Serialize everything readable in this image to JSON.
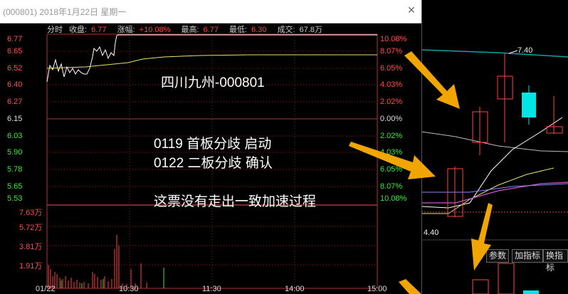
{
  "window": {
    "title": "(000801) 2018年1月22日 星期一",
    "close_icon": "×"
  },
  "info": {
    "mode": "分时",
    "close_label": "收盘:",
    "close_value": "6.77",
    "change_label": "涨幅:",
    "change_value": "+10.08%",
    "high_label": "最高:",
    "high_value": "6.77",
    "low_label": "最低:",
    "low_value": "6.30",
    "volume_label": "成交:",
    "volume_value": "67.8万"
  },
  "price_axis": [
    "6.77",
    "6.65",
    "6.52",
    "6.40",
    "6.27",
    "6.15",
    "6.03",
    "5.90",
    "5.78",
    "5.65",
    "5.53"
  ],
  "pct_axis": [
    "10.08%",
    "8.07%",
    "6.05%",
    "4.03%",
    "2.02%",
    "0.00%",
    "2.02%",
    "4.03%",
    "6.05%",
    "8.07%",
    "10.08%"
  ],
  "volume_axis": [
    "7.63万",
    "5.72万",
    "3.81万",
    "1.91万"
  ],
  "time_axis": [
    "01/22",
    "10:30",
    "11:30",
    "14:00",
    "15:00"
  ],
  "annotations": {
    "stock": "四川九州-000801",
    "line1": "0119 首板分歧 启动",
    "line2": "0122 二板分歧 确认",
    "line3": "这票没有走出一致加速过程"
  },
  "kline": {
    "high_label": "7.40",
    "low_label": "4.40"
  },
  "buttons": {
    "params": "参数",
    "add_indicator": "加指标",
    "switch_indicator": "换指标"
  },
  "colors": {
    "up": "#ff4444",
    "down": "#00e5e5",
    "arrow": "#f0a500"
  }
}
